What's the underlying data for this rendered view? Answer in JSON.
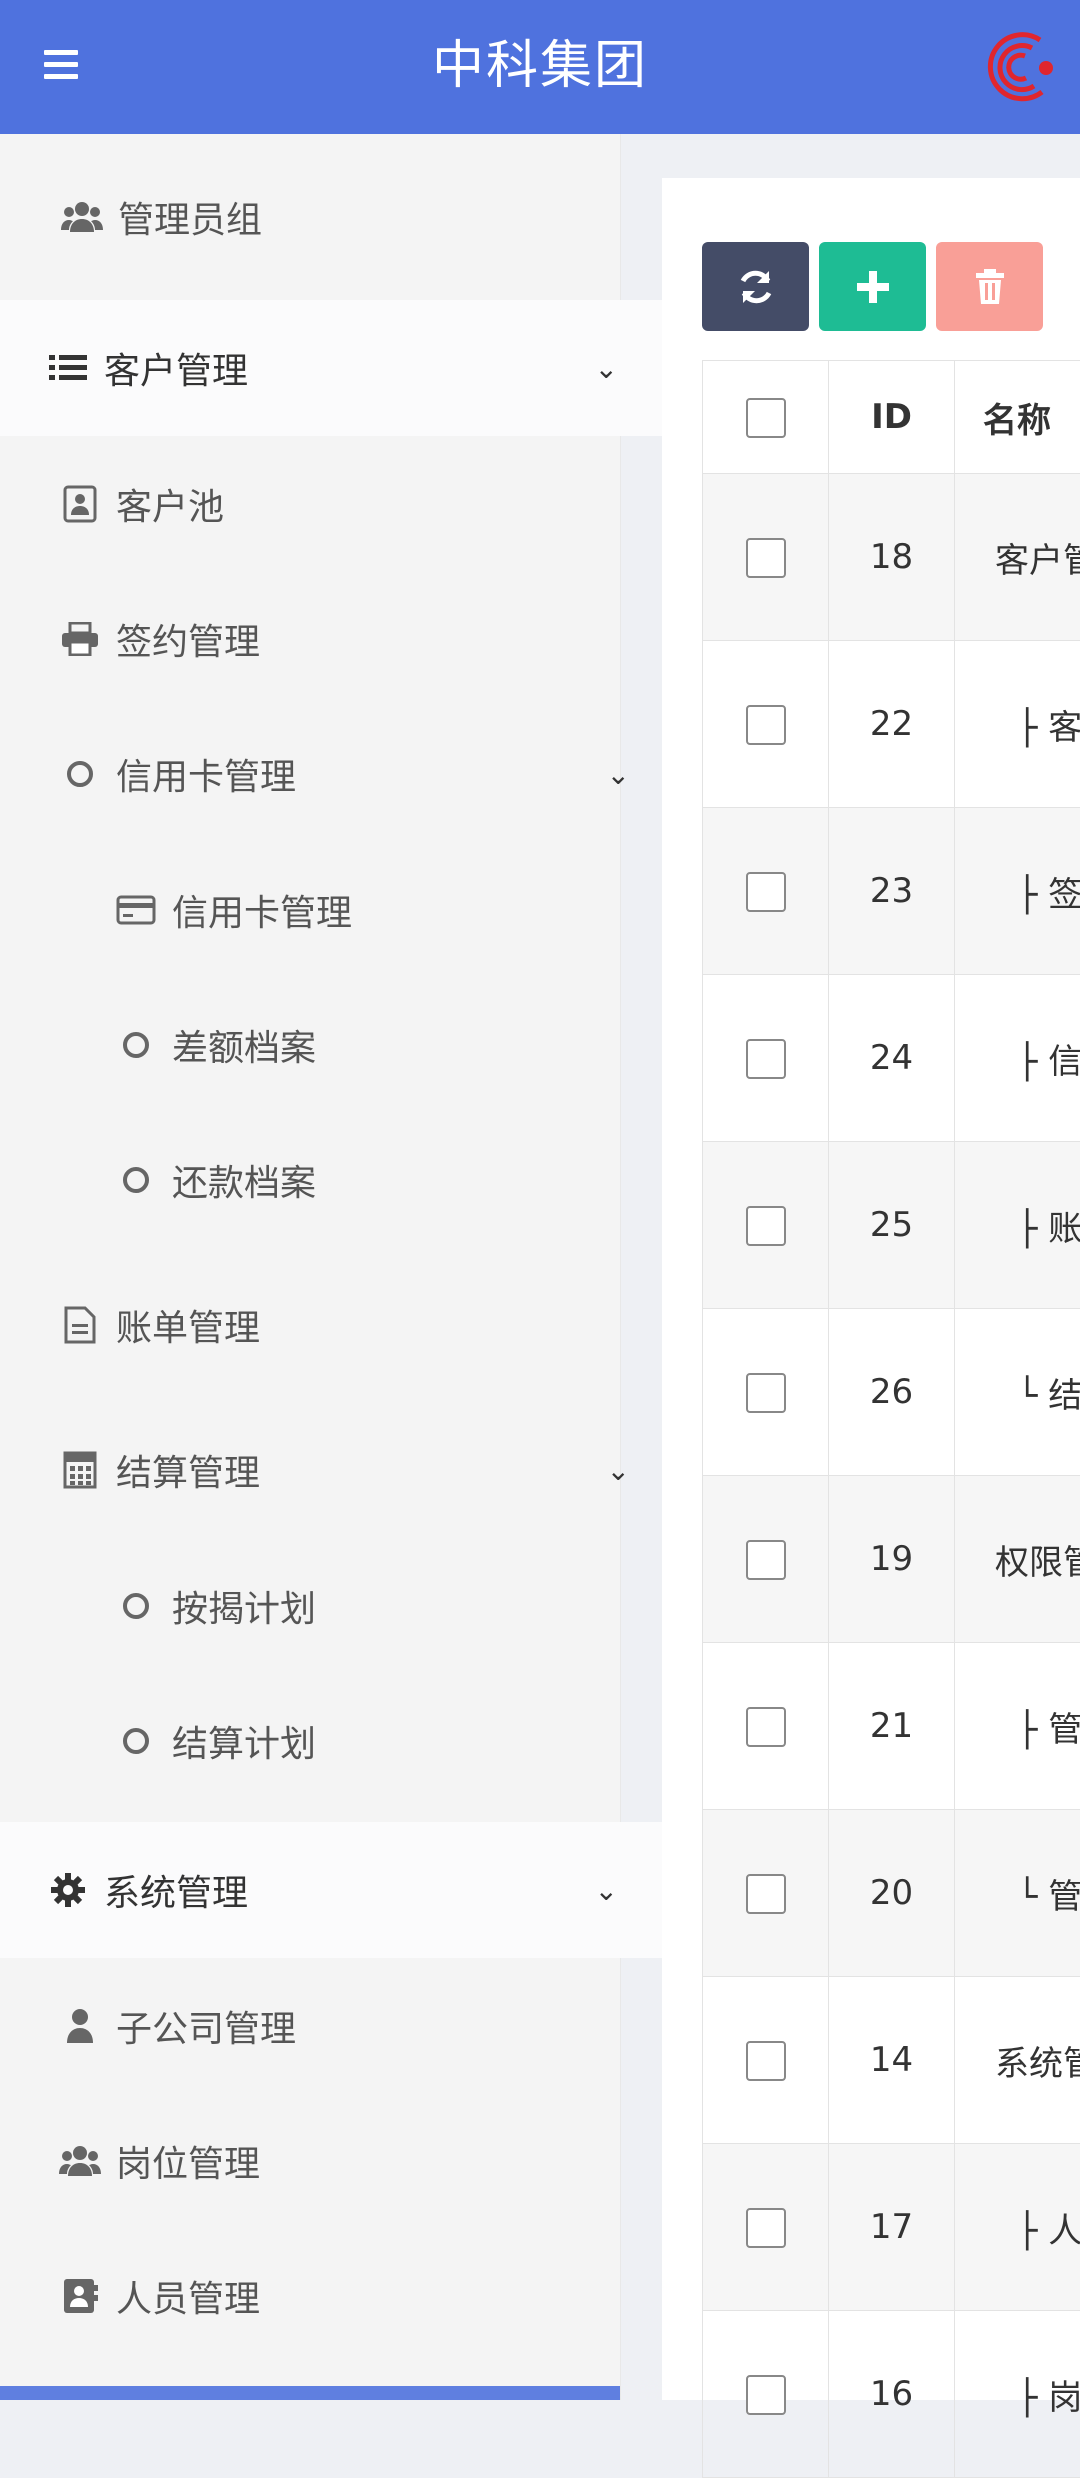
{
  "header": {
    "title": "中科集团",
    "menu_icon": "hamburger-menu-icon",
    "logo_color": "#e0262e"
  },
  "colors": {
    "primary": "#4f72de",
    "refresh_btn": "#444c67",
    "add_btn": "#1ebc94",
    "delete_btn": "#f99f97"
  },
  "sidebar": {
    "items": [
      {
        "label": "管理员组",
        "icon": "users-icon"
      },
      {
        "label": "客户管理",
        "icon": "list-icon"
      },
      {
        "label": "客户池",
        "icon": "contact-card-icon"
      },
      {
        "label": "签约管理",
        "icon": "printer-icon"
      },
      {
        "label": "信用卡管理",
        "icon": "circle-icon"
      },
      {
        "label": "信用卡管理",
        "icon": "credit-card-icon"
      },
      {
        "label": "差额档案",
        "icon": "circle-icon"
      },
      {
        "label": "还款档案",
        "icon": "circle-icon"
      },
      {
        "label": "账单管理",
        "icon": "document-icon"
      },
      {
        "label": "结算管理",
        "icon": "calculator-icon"
      },
      {
        "label": "按揭计划",
        "icon": "circle-icon"
      },
      {
        "label": "结算计划",
        "icon": "circle-icon"
      },
      {
        "label": "系统管理",
        "icon": "gear-icon"
      },
      {
        "label": "子公司管理",
        "icon": "user-icon"
      },
      {
        "label": "岗位管理",
        "icon": "users-icon"
      },
      {
        "label": "人员管理",
        "icon": "id-card-icon"
      }
    ]
  },
  "toolbar": {
    "refresh_icon": "refresh-icon",
    "add_icon": "plus-icon",
    "delete_icon": "trash-icon"
  },
  "table": {
    "headers": {
      "id": "ID",
      "name": "名称"
    },
    "rows": [
      {
        "id": "18",
        "name": "客户管"
      },
      {
        "id": "22",
        "name": "├ 客"
      },
      {
        "id": "23",
        "name": "├ 签"
      },
      {
        "id": "24",
        "name": "├ 信"
      },
      {
        "id": "25",
        "name": "├ 账"
      },
      {
        "id": "26",
        "name": "└ 结"
      },
      {
        "id": "19",
        "name": "权限管"
      },
      {
        "id": "21",
        "name": "├ 管"
      },
      {
        "id": "20",
        "name": "└ 管"
      },
      {
        "id": "14",
        "name": "系统管"
      },
      {
        "id": "17",
        "name": "├ 人"
      },
      {
        "id": "16",
        "name": "├ 岗"
      }
    ]
  }
}
